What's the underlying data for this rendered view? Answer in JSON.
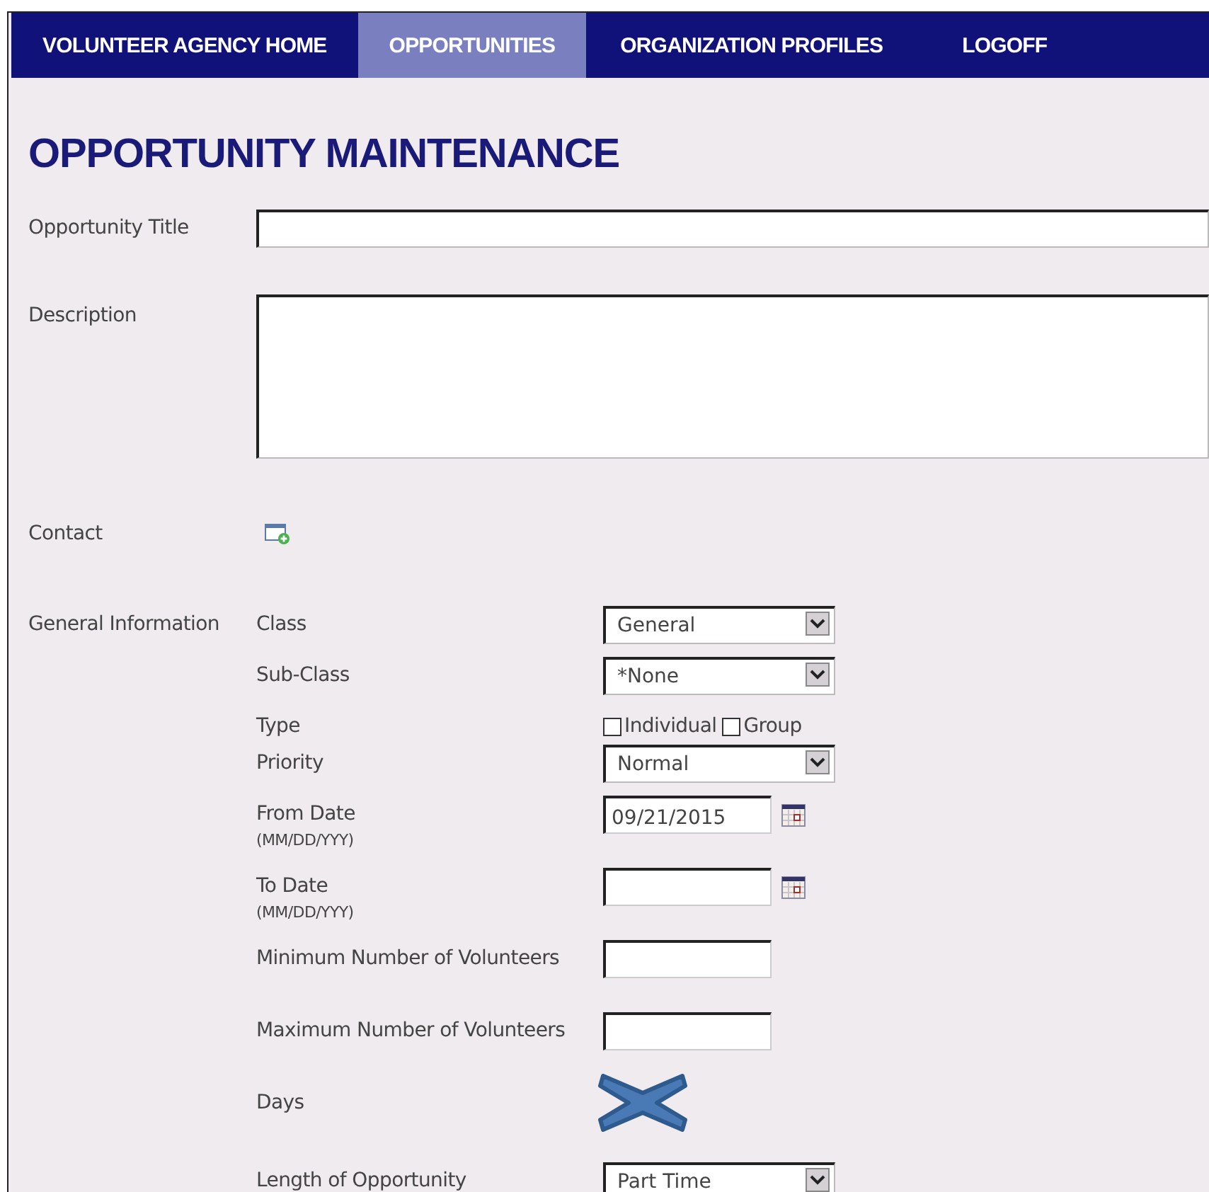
{
  "nav": [
    {
      "label": "VOLUNTEER AGENCY HOME",
      "selected": false
    },
    {
      "label": "OPPORTUNITIES",
      "selected": true
    },
    {
      "label": "ORGANIZATION PROFILES",
      "selected": false
    },
    {
      "label": "LOGOFF",
      "selected": false
    }
  ],
  "heading": "OPPORTUNITY MAINTENANCE",
  "fields": [
    {
      "label": "Opportunity Title",
      "kind": "text"
    },
    {
      "label": "Description",
      "kind": "textarea"
    },
    {
      "label": "Contact",
      "kind": "add"
    }
  ],
  "general": {
    "label": "General Information",
    "rows": [
      {
        "label": "Class",
        "kind": "select",
        "value": "General"
      },
      {
        "label": "Sub-Class",
        "kind": "select",
        "value": "*None"
      },
      {
        "label": "Type",
        "kind": "checks",
        "options": [
          {
            "label": "Individual",
            "checked": false
          },
          {
            "label": "Group",
            "checked": false
          }
        ]
      },
      {
        "label": "Priority",
        "kind": "select",
        "value": "Normal"
      },
      {
        "label": "From Date",
        "hint": "(MM/DD/YYY)",
        "kind": "date",
        "value": "09/21/2015"
      },
      {
        "label": "To Date",
        "hint": "(MM/DD/YYY)",
        "kind": "date"
      },
      {
        "label": "Minimum Number of Volunteers",
        "kind": "number"
      },
      {
        "label": "Maximum Number of Volunteers",
        "kind": "number"
      },
      {
        "label": "Days",
        "kind": "crossed"
      },
      {
        "label": "Length of Opportunity",
        "kind": "select",
        "value": "Part Time"
      }
    ]
  }
}
